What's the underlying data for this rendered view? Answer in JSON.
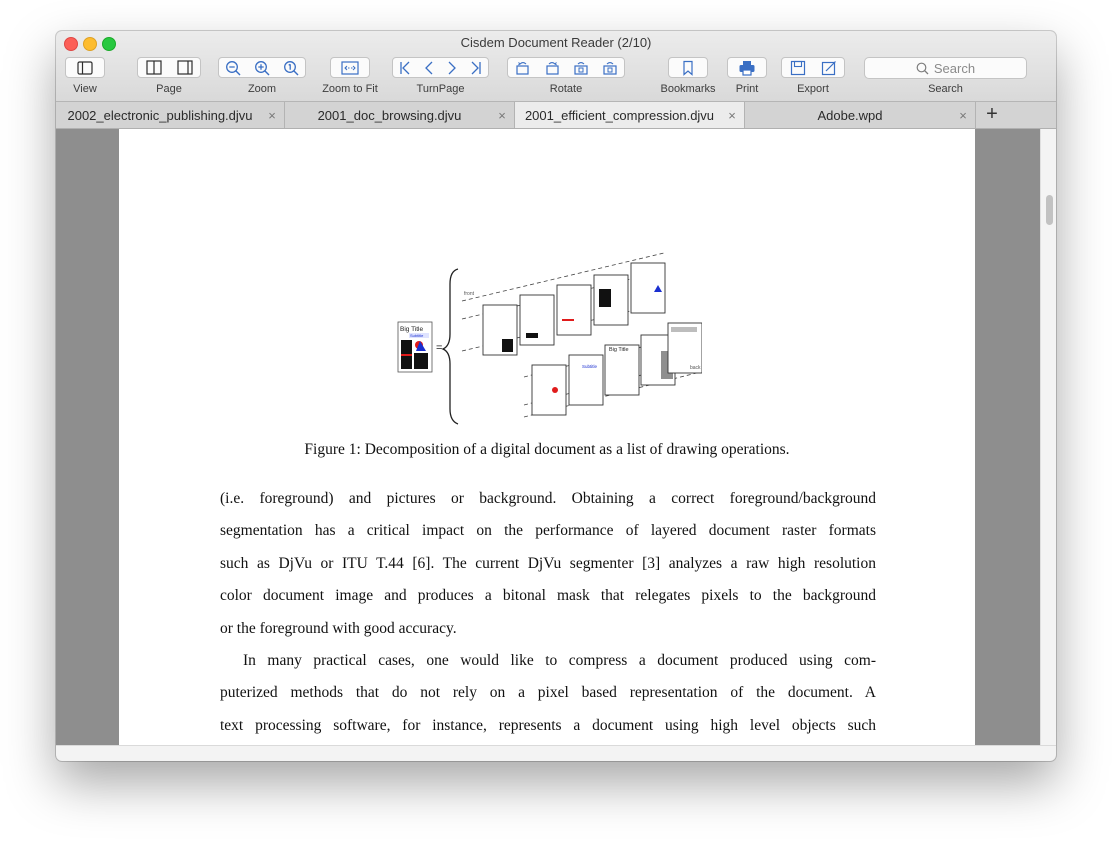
{
  "window": {
    "title": "Cisdem Document Reader (2/10)"
  },
  "toolbar": {
    "view_label": "View",
    "page_label": "Page",
    "zoom_label": "Zoom",
    "zoom_fit_label": "Zoom to Fit",
    "turnpage_label": "TurnPage",
    "rotate_label": "Rotate",
    "bookmarks_label": "Bookmarks",
    "print_label": "Print",
    "export_label": "Export",
    "search_label": "Search",
    "search_placeholder": "Search"
  },
  "tabs": [
    {
      "label": "2002_electronic_publishing.djvu",
      "active": false
    },
    {
      "label": "2001_doc_browsing.djvu",
      "active": false
    },
    {
      "label": "2001_efficient_compression.djvu",
      "active": true
    },
    {
      "label": "Adobe.wpd",
      "active": false
    }
  ],
  "tab_close_glyph": "×",
  "new_tab_glyph": "+",
  "figure": {
    "label_front": "front",
    "label_back": "back",
    "big_title": "Big Title",
    "subtitle": "Subtitle",
    "equals": "="
  },
  "document": {
    "caption": "Figure 1: Decomposition of a digital document as a list of drawing operations.",
    "para1_lines": [
      "(i.e. foreground) and pictures or background. Obtaining a correct foreground/background",
      "segmentation has a critical impact on the performance of layered document raster formats",
      "such as DjVu or ITU T.44 [6]. The current DjVu segmenter [3] analyzes a raw high resolution",
      "color document image and produces a bitonal mask that relegates pixels to the background",
      "or the foreground with good accuracy."
    ],
    "para2_lines": [
      "In many practical cases, one would like to compress a document produced using com-",
      "puterized methods that do not rely on a pixel based representation of the document. A",
      "text processing software, for instance, represents a document using high level objects such"
    ]
  },
  "colors": {
    "accent": "#3a6fc4",
    "pane_bg": "#8e8e8e",
    "red_mark": "#e01b1b",
    "blue_mark": "#1a2fd0"
  }
}
